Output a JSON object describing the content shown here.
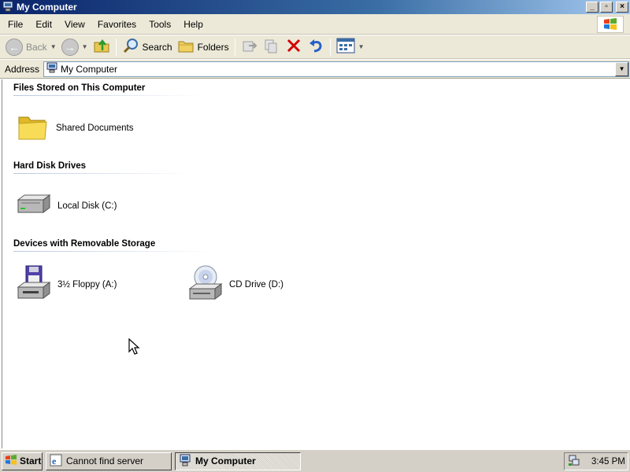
{
  "window": {
    "title": "My Computer",
    "icon": "computer-icon",
    "controls": [
      "minimize",
      "maximize",
      "close"
    ]
  },
  "menubar": {
    "items": [
      "File",
      "Edit",
      "View",
      "Favorites",
      "Tools",
      "Help"
    ]
  },
  "toolbar": {
    "back_label": "Back",
    "search_label": "Search",
    "folders_label": "Folders"
  },
  "address": {
    "label": "Address",
    "value": "My Computer"
  },
  "groups": [
    {
      "header": "Files Stored on This Computer",
      "items": [
        {
          "label": "Shared Documents",
          "icon": "folder-icon"
        }
      ]
    },
    {
      "header": "Hard Disk Drives",
      "items": [
        {
          "label": "Local Disk (C:)",
          "icon": "hard-disk-icon"
        }
      ]
    },
    {
      "header": "Devices with Removable Storage",
      "items": [
        {
          "label": "3½ Floppy (A:)",
          "icon": "floppy-drive-icon"
        },
        {
          "label": "CD Drive (D:)",
          "icon": "cd-drive-icon"
        }
      ]
    }
  ],
  "taskbar": {
    "start_label": "Start",
    "tasks": [
      {
        "label": "Cannot find server",
        "active": false
      },
      {
        "label": "My Computer",
        "active": true
      }
    ],
    "clock": "3:45 PM"
  },
  "colors": {
    "titlebar_dark": "#0a246a",
    "titlebar_light": "#a6caf0",
    "chrome": "#ece9d8",
    "delete_red": "#d40000"
  }
}
